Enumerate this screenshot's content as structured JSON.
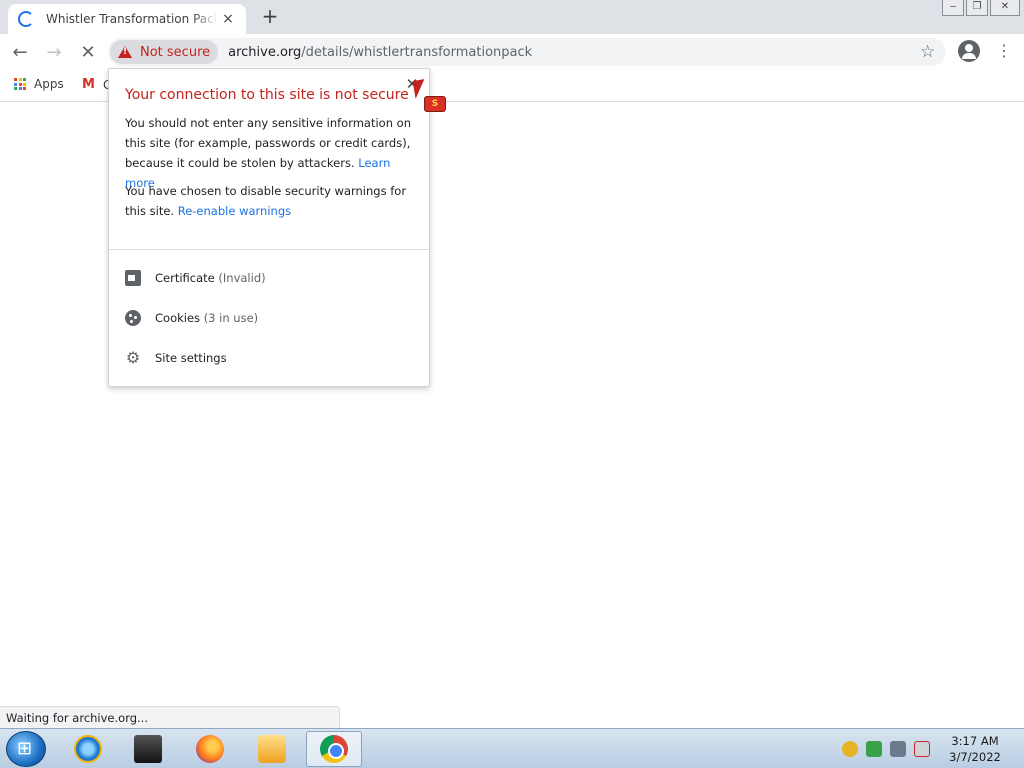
{
  "browser": {
    "tab": {
      "title": "Whistler Transformation Pack : Free Download, Borrow, and Streaming : Internet Archive",
      "close_glyph": "×"
    },
    "new_tab_glyph": "+",
    "window_controls": {
      "minimize": "‒",
      "maximize": "❐",
      "close": "✕"
    },
    "toolbar": {
      "back_glyph": "←",
      "forward_glyph": "→",
      "stop_glyph": "✕",
      "security_label": "Not secure",
      "url_host": "archive.org",
      "url_path": "/details/whistlertransformationpack",
      "star_glyph": "☆",
      "menu_glyph": "⋮"
    },
    "bookmarks": {
      "apps_label": "Apps",
      "gmail_letter": "M",
      "gmail_label": "G",
      "apps_colors": [
        "#ea4335",
        "#fbbc05",
        "#34a853",
        "#4285f4",
        "#ea4335",
        "#fbbc05",
        "#34a853",
        "#4285f4",
        "#ea4335"
      ]
    }
  },
  "security_bubble": {
    "close_glyph": "✕",
    "title": "Your connection to this site is not secure",
    "paragraph1": "You should not enter any sensitive information on this site (for example, passwords or credit cards), because it could be stolen by attackers.",
    "learn_more": "Learn more",
    "paragraph2": "You have chosen to disable security warnings for this site.",
    "reenable": "Re-enable warnings",
    "rows": [
      {
        "label": "Certificate",
        "detail": "(Invalid)",
        "icon": "certificate-icon"
      },
      {
        "label": "Cookies",
        "detail": "(3 in use)",
        "icon": "cookie-icon"
      },
      {
        "label": "Site settings",
        "detail": "",
        "icon": "gear-icon"
      }
    ]
  },
  "status": {
    "text": "Waiting for archive.org..."
  },
  "taskbar": {
    "apps": [
      {
        "name": "Internet Explorer",
        "icon": "internet-explorer-icon"
      },
      {
        "name": "CM",
        "icon": "cm-app-icon"
      },
      {
        "name": "Firefox",
        "icon": "firefox-icon"
      },
      {
        "name": "Media player",
        "icon": "media-player-icon"
      },
      {
        "name": "Google Chrome",
        "icon": "chrome-icon",
        "active": true
      }
    ],
    "clock_time": "3:17 AM",
    "clock_date": "3/7/2022"
  },
  "cursor_badge": "S"
}
